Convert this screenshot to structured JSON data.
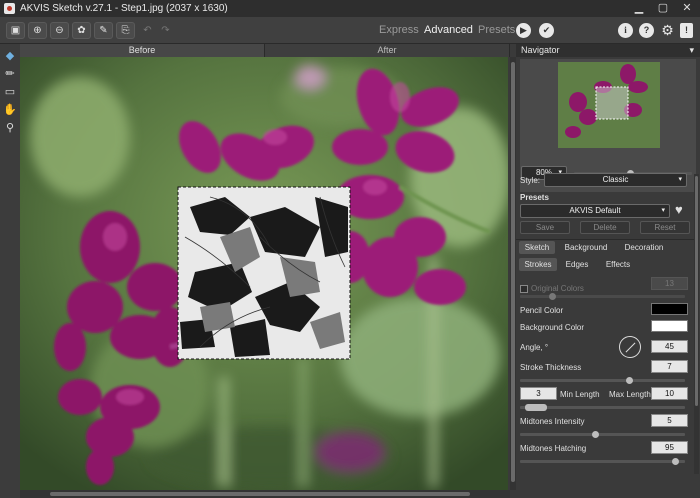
{
  "window": {
    "title": "AKVIS Sketch v.27.1 - Step1.jpg (2037 x 1630)"
  },
  "toolbar": {
    "modes": {
      "express": "Express",
      "advanced": "Advanced",
      "presets": "Presets"
    },
    "undo": "↶",
    "redo": "↷",
    "run_glyph": "▶",
    "apply_glyph": "✔"
  },
  "view_tabs": {
    "before": "Before",
    "after": "After"
  },
  "navigator": {
    "title": "Navigator",
    "zoom": "80%"
  },
  "settings": {
    "style_label": "Style:",
    "style_value": "Classic",
    "presets_label": "Presets",
    "preset_value": "AKVIS Default",
    "buttons": {
      "save": "Save",
      "delete": "Delete",
      "reset": "Reset"
    },
    "tabs": [
      "Sketch",
      "Background",
      "Decoration"
    ],
    "subtabs": [
      "Strokes",
      "Edges",
      "Effects"
    ],
    "original_colors": {
      "label": "Original Colors",
      "value": "13",
      "checked": false
    },
    "pencil_color_label": "Pencil Color",
    "pencil_color": "#000000",
    "background_color_label": "Background Color",
    "background_color": "#ffffff",
    "angle": {
      "label": "Angle, °",
      "value": "45"
    },
    "stroke_thickness": {
      "label": "Stroke Thickness",
      "value": "7"
    },
    "min_length": {
      "label": "Min Length",
      "value": "3"
    },
    "max_length": {
      "label": "Max Length",
      "value": "10"
    },
    "midtones_intensity": {
      "label": "Midtones Intensity",
      "value": "5"
    },
    "midtones_hatching": {
      "label": "Midtones Hatching",
      "value": "95"
    }
  },
  "colors": {
    "accent": "#8e1a66",
    "panel": "#3a3a3a",
    "titlebar": "#2e2e2e"
  }
}
